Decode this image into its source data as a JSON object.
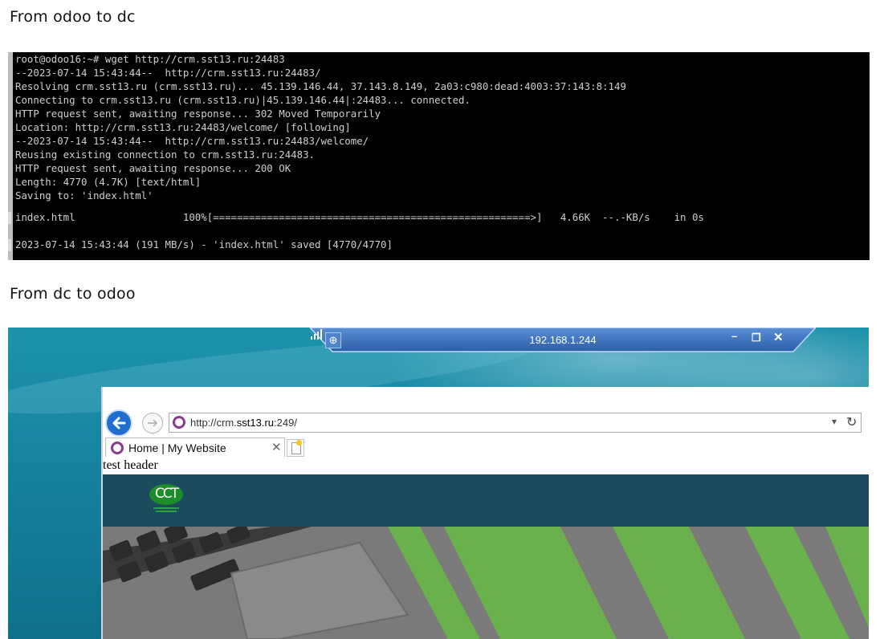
{
  "captions": {
    "first": "From odoo to dc",
    "second": "From dc to odoo"
  },
  "terminal": {
    "lines": [
      "root@odoo16:~# wget http://crm.sst13.ru:24483",
      "--2023-07-14 15:43:44--  http://crm.sst13.ru:24483/",
      "Resolving crm.sst13.ru (crm.sst13.ru)... 45.139.146.44, 37.143.8.149, 2a03:c980:dead:4003:37:143:8:149",
      "Connecting to crm.sst13.ru (crm.sst13.ru)|45.139.146.44|:24483... connected.",
      "HTTP request sent, awaiting response... 302 Moved Temporarily",
      "Location: http://crm.sst13.ru:24483/welcome/ [following]",
      "--2023-07-14 15:43:44--  http://crm.sst13.ru:24483/welcome/",
      "Reusing existing connection to crm.sst13.ru:24483.",
      "HTTP request sent, awaiting response... 200 OK",
      "Length: 4770 (4.7K) [text/html]",
      "Saving to: 'index.html'",
      "",
      "index.html                  100%[=====================================================>]   4.66K  --.-KB/s    in 0s",
      "",
      "2023-07-14 15:43:44 (191 MB/s) - 'index.html' saved [4770/4770]"
    ]
  },
  "remote": {
    "title": "192.168.1.244",
    "pin_icon": "pin-icon",
    "signal_icon": "signal-icon",
    "minimize": "–",
    "restore": "❐",
    "close": "✕"
  },
  "browser": {
    "address_prefix": "http://crm.",
    "address_host": "sst13.ru",
    "address_suffix": ":249/",
    "dropdown": "▾",
    "refresh": "↻",
    "tab_label": "Home | My Website",
    "tab_close": "✕",
    "page_header": "test header",
    "logo_text": "CCT"
  },
  "colors": {
    "terminal_bg": "#000000",
    "site_nav_bg": "#1c4b5e",
    "ie_back": "#1e6fd0",
    "logo_green": "#1d8d2a",
    "hero_green": "#6ab04c"
  }
}
